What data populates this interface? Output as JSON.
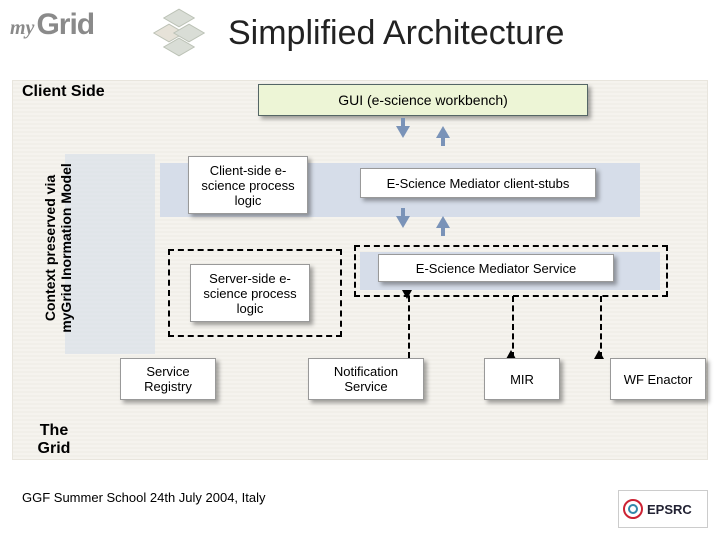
{
  "header": {
    "logo_my": "my",
    "logo_grid": "Grid",
    "title": "Simplified Architecture"
  },
  "labels": {
    "client_side": "Client Side",
    "the_grid": "The Grid",
    "context1": "Context preserved via",
    "context2": "myGrid Inormation Model"
  },
  "boxes": {
    "gui": "GUI (e-science workbench)",
    "client_logic": "Client-side e-science process logic",
    "client_stubs": "E-Science Mediator client-stubs",
    "server_logic": "Server-side e-science process logic",
    "mediator_service": "E-Science Mediator Service",
    "service_registry": "Service Registry",
    "notification_service": "Notification Service",
    "mir": "MIR",
    "wf_enactor": "WF Enactor"
  },
  "footer": "GGF Summer School 24th July 2004, Italy",
  "sponsor": "EPSRC"
}
